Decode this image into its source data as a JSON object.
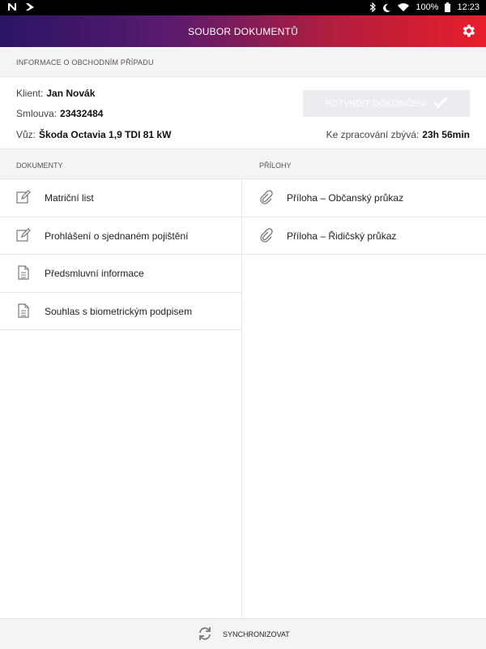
{
  "status_bar": {
    "battery": "100%",
    "time": "12:23"
  },
  "app_bar": {
    "title": "SOUBOR DOKUMENTŮ"
  },
  "case_info": {
    "section_label": "INFORMACE O OBCHODNÍM PŘÍPADU",
    "client_label": "Klient:",
    "client_value": "Jan Novák",
    "contract_label": "Smlouva:",
    "contract_value": "23432484",
    "car_label": "Vůz:",
    "car_value": "Škoda Octavia 1,9 TDI 81 kW",
    "confirm_label": "POTVRDIT DOKONČENÍ",
    "remaining_label": "Ke zpracování zbývá:",
    "remaining_value": "23h 56min"
  },
  "documents": {
    "header": "DOKUMENTY",
    "items": [
      {
        "label": "Matriční list",
        "icon": "edit-icon"
      },
      {
        "label": "Prohlášení o sjednaném pojištění",
        "icon": "edit-icon"
      },
      {
        "label": "Předsmluvní informace",
        "icon": "document-icon"
      },
      {
        "label": "Souhlas s biometrickým podpisem",
        "icon": "document-icon"
      }
    ]
  },
  "attachments": {
    "header": "PŘÍLOHY",
    "items": [
      {
        "label": "Příloha – Občanský průkaz",
        "icon": "paperclip-icon"
      },
      {
        "label": "Příloha – Řidičský průkaz",
        "icon": "paperclip-icon"
      }
    ]
  },
  "bottom_bar": {
    "sync_label": "SYNCHRONIZOVAT"
  },
  "colors": {
    "gradient_start": "#2b1564",
    "gradient_end": "#e81e2a",
    "confirm_disabled": "#ececf0"
  }
}
